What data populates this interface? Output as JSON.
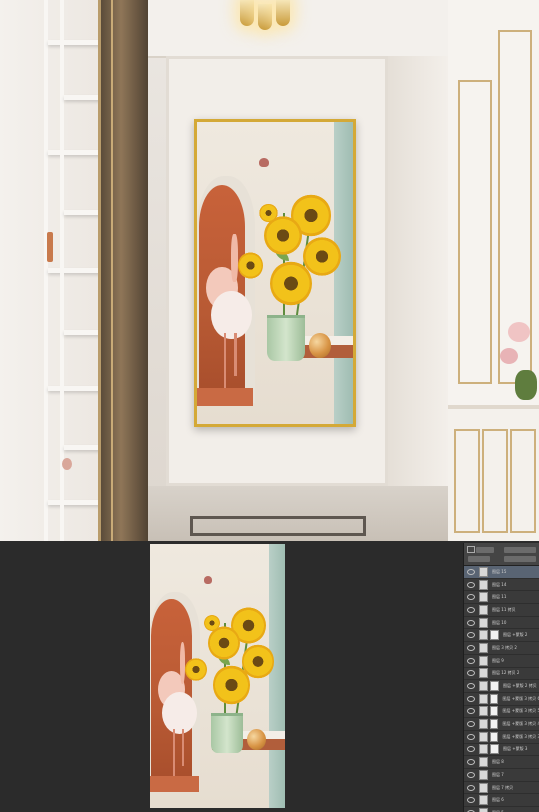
{
  "scene": {
    "description_visible_text": "",
    "colors": {
      "frame_gold": "#d4a937",
      "arch_terracotta": "#c8623a",
      "sunflower_yellow": "#f2c21a",
      "teal_wall": "#9fbdb2",
      "background_dark": "#2b2b2b"
    }
  },
  "layers_panel": {
    "header_icon": "layers-icon",
    "rows": [
      {
        "name": "图层 15",
        "selected": true
      },
      {
        "name": "图层 14"
      },
      {
        "name": "图层 11"
      },
      {
        "name": "图层 11 拷贝"
      },
      {
        "name": "图层 10"
      },
      {
        "name": "图层 +蒙版 2"
      },
      {
        "name": "图层 3 拷贝 2"
      },
      {
        "name": "图层 9"
      },
      {
        "name": "图层 12 拷贝 2"
      },
      {
        "name": "图层 +蒙版 2 拷贝"
      },
      {
        "name": "图层 +蒙版 3 拷贝 6"
      },
      {
        "name": "图层 +蒙版 3 拷贝 5"
      },
      {
        "name": "图层 +蒙版 3 拷贝 4"
      },
      {
        "name": "图层 +蒙版 3 拷贝 3"
      },
      {
        "name": "图层 +蒙版 3"
      },
      {
        "name": "图层 8"
      },
      {
        "name": "图层 7"
      },
      {
        "name": "图层 7 拷贝"
      },
      {
        "name": "图层 6"
      },
      {
        "name": "图层 5"
      }
    ]
  }
}
